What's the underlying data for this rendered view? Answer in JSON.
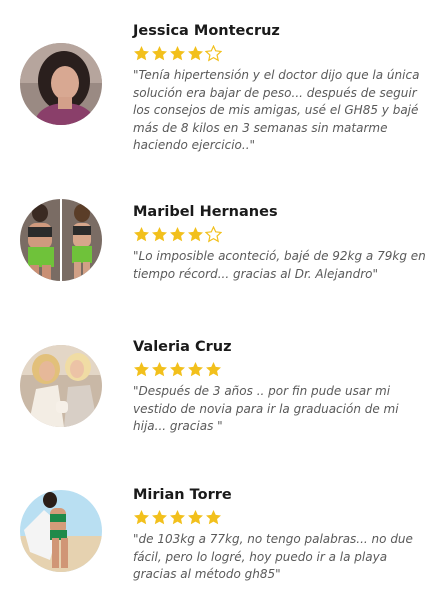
{
  "reviews": [
    {
      "name": "Jessica Montecruz",
      "rating": 4,
      "max_rating": 5,
      "quote": "\"Tenía hipertensión y el doctor dijo que la única solución era bajar de peso... después de seguir los consejos de mis amigas, usé el GH85 y bajé más de 8 kilos en 3 semanas sin matarme haciendo ejercicio..\""
    },
    {
      "name": "Maribel Hernanes",
      "rating": 4,
      "max_rating": 5,
      "quote": "\"Lo imposible aconteció, bajé de 92kg a 79kg en tiempo récord... gracias al Dr. Alejandro\""
    },
    {
      "name": "Valeria Cruz",
      "rating": 5,
      "max_rating": 5,
      "quote": "\"Después de 3 años .. por fin pude usar mi vestido de novia para ir la graduación de mi hija... gracias \""
    },
    {
      "name": "Mirian Torre",
      "rating": 5,
      "max_rating": 5,
      "quote": "\"de 103kg a 77kg, no tengo palabras... no due fácil, pero lo logré, hoy puedo ir a la playa gracias al método gh85\""
    }
  ],
  "colors": {
    "star_filled": "#f2c01c",
    "star_empty_outline": "#f2c01c",
    "name_text": "#1a1a1a",
    "quote_text": "#5a5a5a"
  },
  "icons": {
    "star_filled": "star-filled-icon",
    "star_empty": "star-outline-icon"
  }
}
